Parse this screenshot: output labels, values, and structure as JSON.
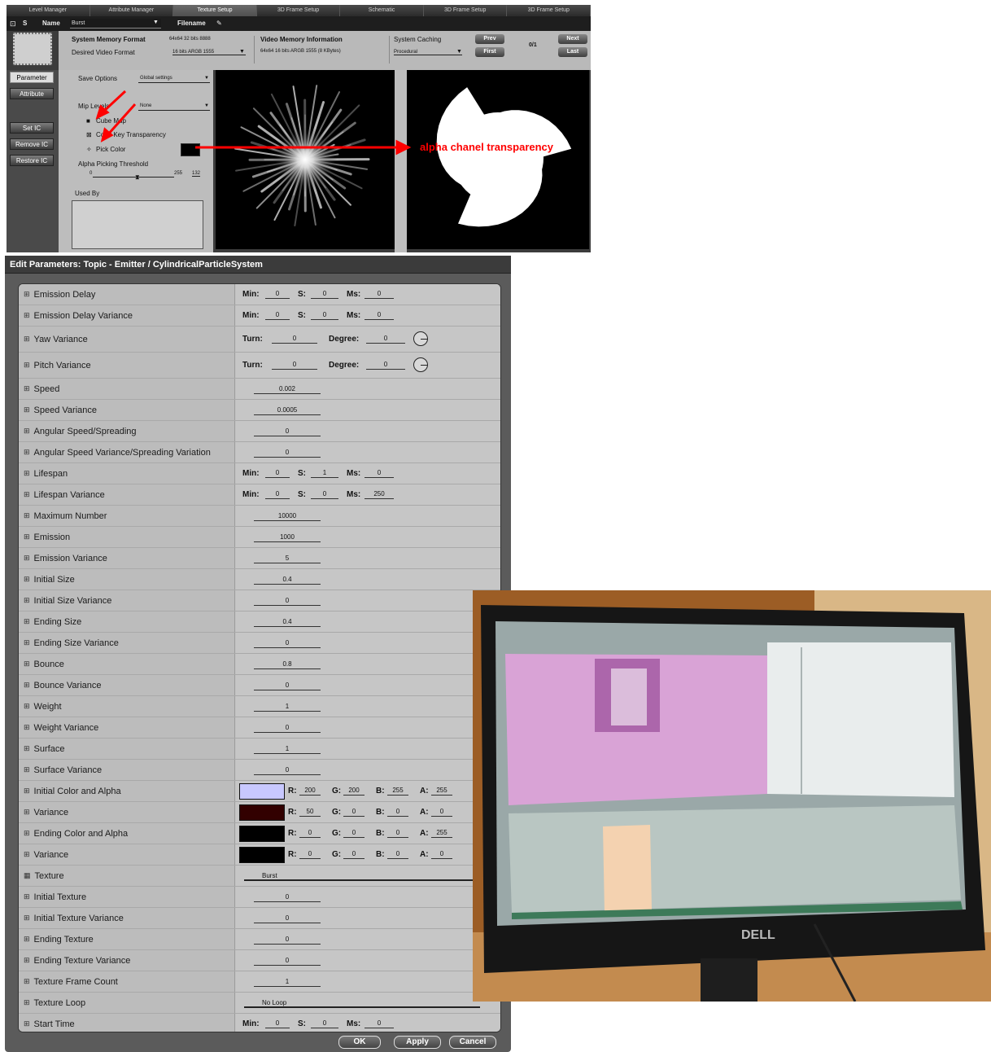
{
  "texture_setup": {
    "tabs": [
      "Level Manager",
      "Attribute Manager",
      "Texture Setup",
      "3D Frame Setup",
      "Schematic",
      "3D Frame Setup",
      "3D Frame Setup"
    ],
    "active_tab": 2,
    "name_label": "Name",
    "name_value": "Burst",
    "filename_label": "Filename",
    "system_memory_format_label": "System Memory Format",
    "system_memory_format_value": "64x64 32 bits 8888",
    "desired_video_format_label": "Desired Video Format",
    "desired_video_format_value": "16 bits ARGB 1555",
    "video_memory_label": "Video Memory Information",
    "video_memory_value": "64x64  16 bits ARGB 1555 (8 KBytes)",
    "system_caching_label": "System Caching",
    "system_caching_value": "Procedural",
    "prev_label": "Prev",
    "first_label": "First",
    "next_label": "Next",
    "last_label": "Last",
    "frame_counter": "0/1",
    "side_buttons": [
      "Parameter",
      "Attribute",
      "Set IC",
      "Remove IC",
      "Restore IC"
    ],
    "save_options_label": "Save Options",
    "save_options_value": "Global settings",
    "mip_levels_label": "Mip Levels",
    "mip_levels_value": "None",
    "cube_map_label": "Cube Map",
    "color_key_label": "Color Key Transparency",
    "pick_color_label": "Pick Color",
    "alpha_threshold_label": "Alpha Picking Threshold",
    "slider_min": "0",
    "slider_max": "255",
    "slider_value": "132",
    "used_by_label": "Used By",
    "annotation": "alpha chanel transparency",
    "colors": {
      "annotation": "#ff0000",
      "panel": "#3c3c3c"
    }
  },
  "dialog": {
    "title": "Edit Parameters: Topic - Emitter / CylindricalParticleSystem",
    "rows": [
      {
        "name": "Emission Delay",
        "type": "time",
        "min": "0",
        "s": "0",
        "ms": "0"
      },
      {
        "name": "Emission Delay Variance",
        "type": "time",
        "min": "0",
        "s": "0",
        "ms": "0"
      },
      {
        "name": "Yaw Variance",
        "type": "angle",
        "turn": "0",
        "degree": "0"
      },
      {
        "name": "Pitch Variance",
        "type": "angle",
        "turn": "0",
        "degree": "0"
      },
      {
        "name": "Speed",
        "type": "value",
        "value": "0.002"
      },
      {
        "name": "Speed Variance",
        "type": "value",
        "value": "0.0005"
      },
      {
        "name": "Angular Speed/Spreading",
        "type": "value",
        "value": "0"
      },
      {
        "name": "Angular Speed Variance/Spreading Variation",
        "type": "value",
        "value": "0"
      },
      {
        "name": "Lifespan",
        "type": "time",
        "min": "0",
        "s": "1",
        "ms": "0"
      },
      {
        "name": "Lifespan Variance",
        "type": "time",
        "min": "0",
        "s": "0",
        "ms": "250"
      },
      {
        "name": "Maximum Number",
        "type": "value",
        "value": "10000"
      },
      {
        "name": "Emission",
        "type": "value",
        "value": "1000"
      },
      {
        "name": "Emission Variance",
        "type": "value",
        "value": "5"
      },
      {
        "name": "Initial Size",
        "type": "value",
        "value": "0.4"
      },
      {
        "name": "Initial Size Variance",
        "type": "value",
        "value": "0"
      },
      {
        "name": "Ending Size",
        "type": "value",
        "value": "0.4"
      },
      {
        "name": "Ending Size Variance",
        "type": "value",
        "value": "0"
      },
      {
        "name": "Bounce",
        "type": "value",
        "value": "0.8"
      },
      {
        "name": "Bounce Variance",
        "type": "value",
        "value": "0"
      },
      {
        "name": "Weight",
        "type": "value",
        "value": "1"
      },
      {
        "name": "Weight Variance",
        "type": "value",
        "value": "0"
      },
      {
        "name": "Surface",
        "type": "value",
        "value": "1"
      },
      {
        "name": "Surface Variance",
        "type": "value",
        "value": "0"
      },
      {
        "name": "Initial Color and Alpha",
        "type": "color",
        "r": "200",
        "g": "200",
        "b": "255",
        "a": "255",
        "swatch": "#c8c8ff"
      },
      {
        "name": "Variance",
        "type": "color",
        "r": "50",
        "g": "0",
        "b": "0",
        "a": "0",
        "swatch": "#320000"
      },
      {
        "name": "Ending Color and Alpha",
        "type": "color",
        "r": "0",
        "g": "0",
        "b": "0",
        "a": "255",
        "swatch": "#000000"
      },
      {
        "name": "Variance",
        "type": "color",
        "r": "0",
        "g": "0",
        "b": "0",
        "a": "0",
        "swatch": "#000000"
      },
      {
        "name": "Texture",
        "type": "text",
        "value": "Burst"
      },
      {
        "name": "Initial Texture",
        "type": "value",
        "value": "0"
      },
      {
        "name": "Initial Texture Variance",
        "type": "value",
        "value": "0"
      },
      {
        "name": "Ending Texture",
        "type": "value",
        "value": "0"
      },
      {
        "name": "Ending Texture Variance",
        "type": "value",
        "value": "0"
      },
      {
        "name": "Texture Frame Count",
        "type": "value",
        "value": "1"
      },
      {
        "name": "Texture Loop",
        "type": "text",
        "value": "No Loop"
      },
      {
        "name": "Start Time",
        "type": "time",
        "min": "0",
        "s": "0",
        "ms": "0"
      }
    ],
    "labels": {
      "min": "Min:",
      "s": "S:",
      "ms": "Ms:",
      "turn": "Turn:",
      "degree": "Degree:",
      "r": "R:",
      "g": "G:",
      "b": "B:",
      "a": "A:"
    },
    "ok_label": "OK",
    "apply_label": "Apply",
    "cancel_label": "Cancel"
  },
  "photo": {
    "brand": "DELL"
  }
}
